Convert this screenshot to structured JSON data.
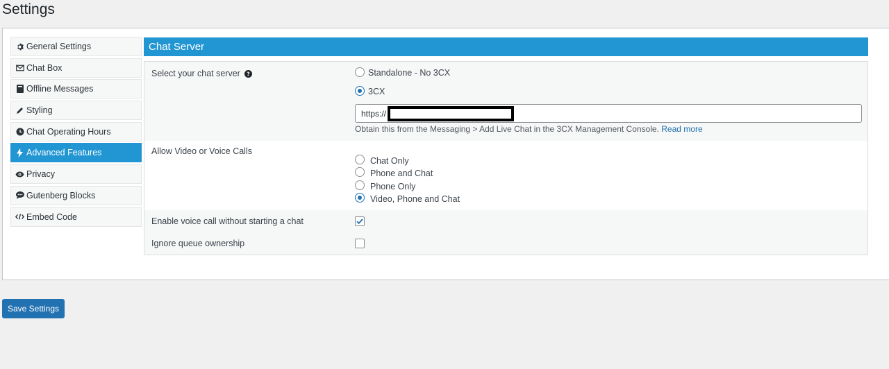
{
  "page": {
    "title": "Settings"
  },
  "sidebar": {
    "items": [
      {
        "label": "General Settings",
        "icon": "gear-icon"
      },
      {
        "label": "Chat Box",
        "icon": "envelope-icon"
      },
      {
        "label": "Offline Messages",
        "icon": "book-icon"
      },
      {
        "label": "Styling",
        "icon": "pencil-icon"
      },
      {
        "label": "Chat Operating Hours",
        "icon": "clock-icon"
      },
      {
        "label": "Advanced Features",
        "icon": "bolt-icon",
        "active": true
      },
      {
        "label": "Privacy",
        "icon": "eye-icon"
      },
      {
        "label": "Gutenberg Blocks",
        "icon": "comment-icon"
      },
      {
        "label": "Embed Code",
        "icon": "code-icon"
      }
    ]
  },
  "section": {
    "title": "Chat Server"
  },
  "chat_server": {
    "label": "Select your chat server",
    "options": [
      {
        "label": "Standalone - No 3CX",
        "checked": false
      },
      {
        "label": "3CX",
        "checked": true
      }
    ],
    "url_value": "https://",
    "help_text": "Obtain this from the Messaging > Add Live Chat in the 3CX Management Console.",
    "help_link": "Read more"
  },
  "calls": {
    "label": "Allow Video or Voice Calls",
    "options": [
      {
        "label": "Chat Only",
        "checked": false
      },
      {
        "label": "Phone and Chat",
        "checked": false
      },
      {
        "label": "Phone Only",
        "checked": false
      },
      {
        "label": "Video, Phone and Chat",
        "checked": true
      }
    ]
  },
  "voice_call": {
    "label": "Enable voice call without starting a chat",
    "checked": true
  },
  "queue": {
    "label": "Ignore queue ownership",
    "checked": false
  },
  "footer": {
    "save_label": "Save Settings"
  },
  "colors": {
    "accent": "#2196d3",
    "button": "#2271b1"
  }
}
